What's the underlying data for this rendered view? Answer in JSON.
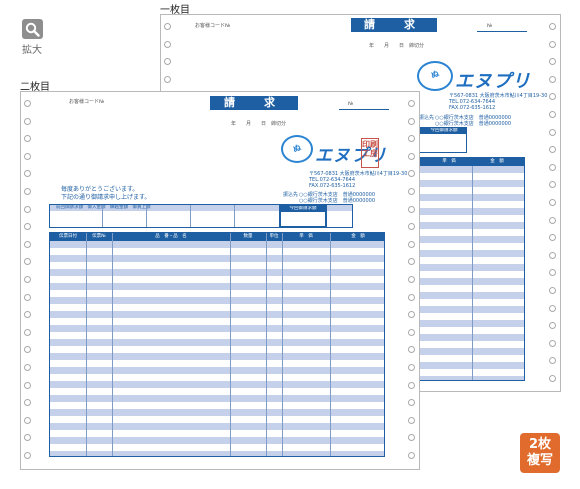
{
  "zoom": {
    "label": "拡大",
    "icon": "magnifier-icon"
  },
  "sheets": {
    "first_label": "一枚目",
    "second_label": "二枚目"
  },
  "invoice": {
    "title": "請　求　書",
    "customer_code": "お客様コード№",
    "number_label": "№",
    "date_line": "年　　月　　日　締切分",
    "greeting_1": "毎度ありがとうございます。",
    "greeting_2": "下記の通り御請求申し上げます。",
    "summary_header": "前回御請求額　御入金額　繰越金額　御買上額",
    "this_time_label": "今回御請求額",
    "bank_label": "振込先",
    "bank_lines": [
      "○○銀行茨木支店　普通0000000",
      "○○銀行茨木支店　普通0000000"
    ],
    "columns": [
      "伝票日付",
      "伝票№",
      "品　番・品　名",
      "数量",
      "単位",
      "単　価",
      "金　額"
    ],
    "company": {
      "logo_text": "エヌプリ",
      "bubble_text": "ぬ",
      "address": "〒567-0831 大阪府茨木市鮎川4丁目19-30",
      "tel": "TEL.072-634-7644",
      "fax": "FAX.072-635-1612"
    },
    "stamp_text": "印刷工房"
  },
  "badge": {
    "line1": "2枚",
    "line2": "複写"
  },
  "colors": {
    "primary": "#1e5fa3",
    "stripe": "#c5d1ea",
    "badge": "#e06b2c"
  }
}
